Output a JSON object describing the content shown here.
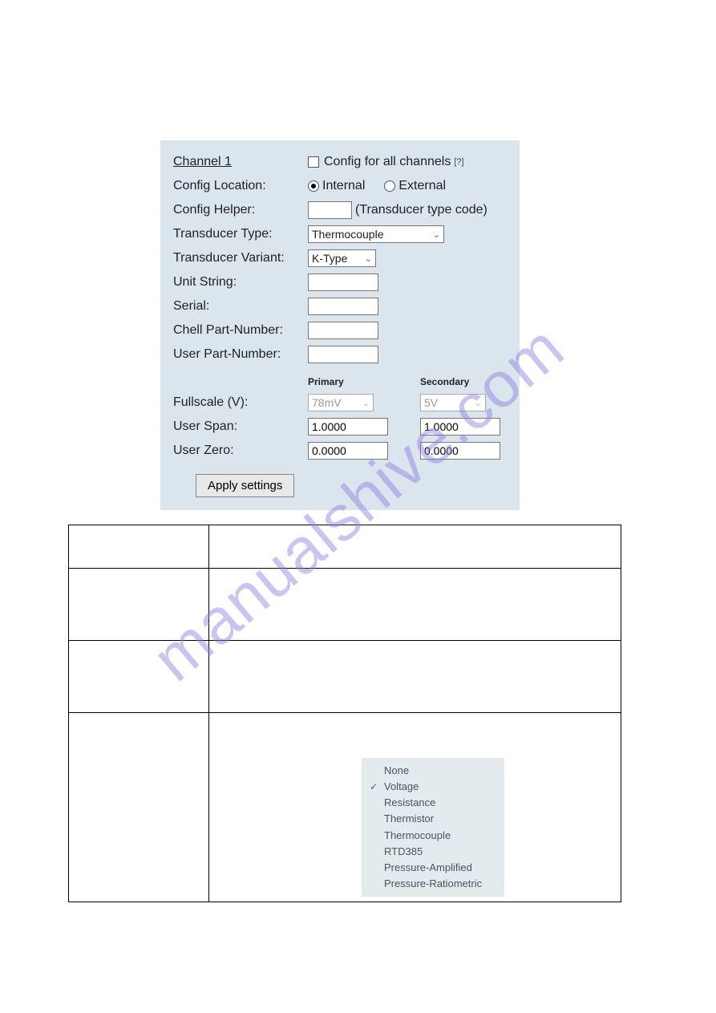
{
  "panel": {
    "channel_title": "Channel 1",
    "config_all_label": "Config for all channels",
    "help_marker": "[?]",
    "config_location_label": "Config Location:",
    "internal_label": "Internal",
    "external_label": "External",
    "config_helper_label": "Config Helper:",
    "config_helper_value": "",
    "config_helper_hint": "(Transducer type code)",
    "transducer_type_label": "Transducer Type:",
    "transducer_type_value": "Thermocouple",
    "transducer_variant_label": "Transducer Variant:",
    "transducer_variant_value": "K-Type",
    "unit_string_label": "Unit String:",
    "unit_string_value": "",
    "serial_label": "Serial:",
    "serial_value": "",
    "chell_pn_label": "Chell Part-Number:",
    "chell_pn_value": "",
    "user_pn_label": "User Part-Number:",
    "user_pn_value": "",
    "primary_hdr": "Primary",
    "secondary_hdr": "Secondary",
    "fullscale_label": "Fullscale (V):",
    "fullscale_primary": "78mV",
    "fullscale_secondary": "5V",
    "user_span_label": "User Span:",
    "user_span_primary": "1.0000",
    "user_span_secondary": "1.0000",
    "user_zero_label": "User Zero:",
    "user_zero_primary": "0.0000",
    "user_zero_secondary": "0.0000",
    "apply_button": "Apply settings"
  },
  "dropdown": {
    "items": [
      "None",
      "Voltage",
      "Resistance",
      "Thermistor",
      "Thermocouple",
      "RTD385",
      "Pressure-Amplified",
      "Pressure-Ratiometric"
    ],
    "selected_index": 1
  },
  "watermark": "manualshive.com"
}
